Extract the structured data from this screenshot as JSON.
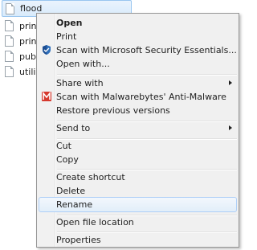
{
  "files": [
    {
      "name": "flood",
      "selected": true
    },
    {
      "name": "print",
      "selected": false
    },
    {
      "name": "print",
      "selected": false
    },
    {
      "name": "publ",
      "selected": false
    },
    {
      "name": "utili",
      "selected": false
    }
  ],
  "menu": {
    "open": "Open",
    "print": "Print",
    "scan_mse": "Scan with Microsoft Security Essentials...",
    "open_with": "Open with...",
    "share_with": "Share with",
    "scan_mbam": "Scan with Malwarebytes' Anti-Malware",
    "restore_versions": "Restore previous versions",
    "send_to": "Send to",
    "cut": "Cut",
    "copy": "Copy",
    "create_shortcut": "Create shortcut",
    "delete": "Delete",
    "rename": "Rename",
    "open_file_location": "Open file location",
    "properties": "Properties"
  },
  "icons": {
    "mse": "microsoft-security-essentials-icon",
    "mbam": "malwarebytes-icon",
    "file": "file-icon"
  },
  "colors": {
    "selection_bg": "#d9ebfb",
    "selection_border": "#99c5ef",
    "menu_bg": "#f0f0f0",
    "menu_border": "#979797",
    "hover_border": "#aecff7"
  }
}
